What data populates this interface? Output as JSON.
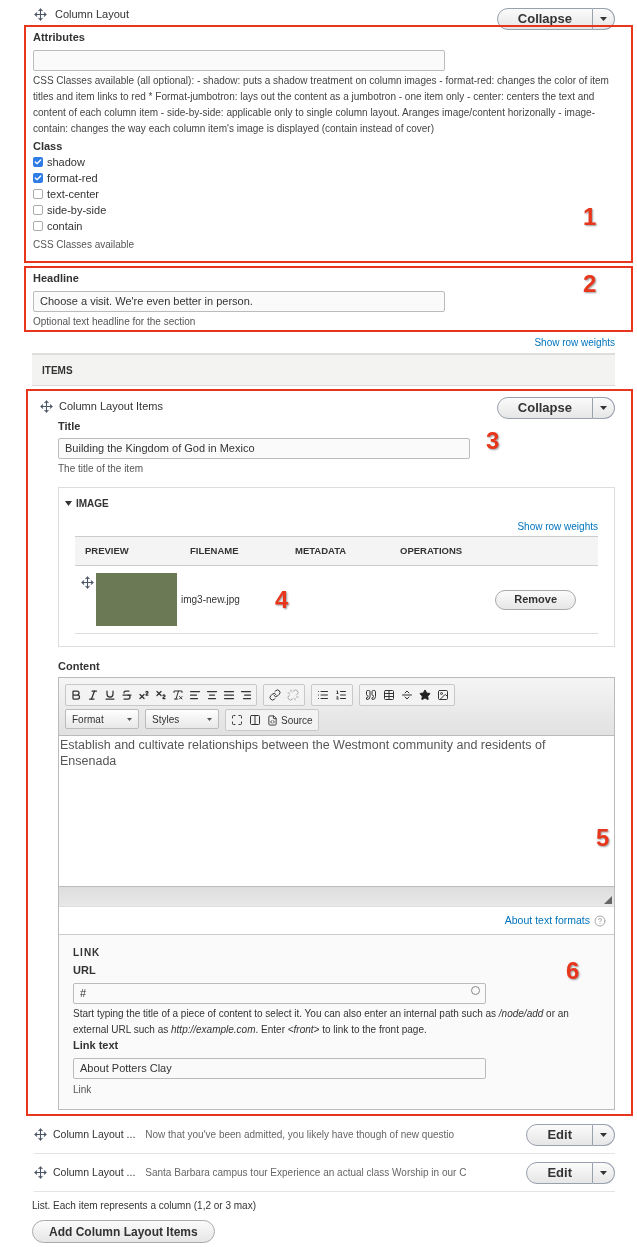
{
  "header": {
    "title": "Column Layout",
    "button": "Collapse"
  },
  "attributes": {
    "marker": "1",
    "label": "Attributes",
    "description": "CSS Classes available (all optional): - shadow: puts a shadow treatment on column images - format-red: changes the color of item titles and item links to red * Format-jumbotron: lays out the content as a jumbotron - one item only  - center: centers the text and content of each column item  - side-by-side: applicable only to single column layout. Aranges image/content horizonally - image-contain: changes the way each column item's image is displayed (contain instead of cover)",
    "class_label": "Class",
    "classes": [
      {
        "label": "shadow",
        "checked": true
      },
      {
        "label": "format-red",
        "checked": true
      },
      {
        "label": "text-center",
        "checked": false
      },
      {
        "label": "side-by-side",
        "checked": false
      },
      {
        "label": "contain",
        "checked": false
      }
    ],
    "help": "CSS Classes available"
  },
  "headline": {
    "marker": "2",
    "label": "Headline",
    "value": "Choose a visit. We're even better in person.",
    "help": "Optional text headline for the section"
  },
  "show_row_weights": "Show row weights",
  "items_header": "ITEMS",
  "item": {
    "title": "Column Layout Items",
    "button": "Collapse",
    "title_field": {
      "marker": "3",
      "label": "Title",
      "value": "Building the Kingdom of God in Mexico",
      "help": "The title of the item"
    },
    "image": {
      "marker": "4",
      "heading": "IMAGE",
      "expanded": true,
      "show_row_weights": "Show row weights",
      "columns": [
        "PREVIEW",
        "FILENAME",
        "METADATA",
        "OPERATIONS"
      ],
      "rows": [
        {
          "filename": "img3-new.jpg",
          "button": "Remove"
        }
      ]
    },
    "content": {
      "marker": "5",
      "label": "Content",
      "format_dropdown": "Format",
      "styles_dropdown": "Styles",
      "source_button": "Source",
      "text": "Establish and cultivate relationships between the Westmont community and residents of Ensenada",
      "about_link": "About text formats"
    },
    "link": {
      "marker": "6",
      "heading": "LINK",
      "url_label": "URL",
      "url_value": "#",
      "url_help": "Start typing the title of a piece of content to select it. You can also enter an internal path such as */node/add* or an external URL such as *http://example.com*. Enter *<front>* to link to the front page.",
      "text_label": "Link text",
      "text_value": "About Potters Clay",
      "help": "Link"
    }
  },
  "collapsed_items": [
    {
      "title": "Column Layout ...",
      "summary": "Now that you've been admitted, you likely have though of new questio",
      "button": "Edit"
    },
    {
      "title": "Column Layout ...",
      "summary": "Santa Barbara campus tour Experience an actual class Worship in our C",
      "button": "Edit"
    }
  ],
  "list_help": "List. Each item represents a column (1,2 or 3 max)",
  "add_button": "Add Column Layout Items"
}
